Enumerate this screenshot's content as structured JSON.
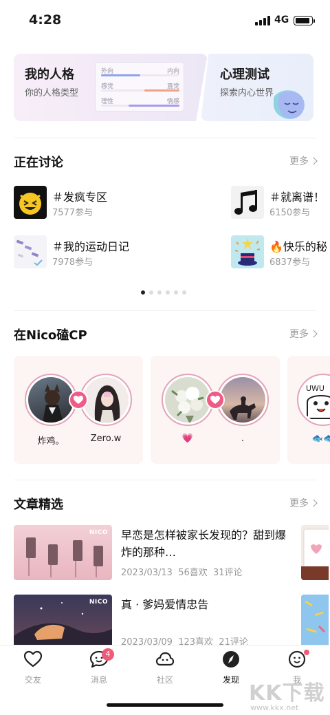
{
  "status": {
    "time": "4:28",
    "network": "4G"
  },
  "persona_card": {
    "title": "我的人格",
    "subtitle": "你的人格类型",
    "rows": [
      {
        "left": "外向",
        "right": "内向",
        "color": "#8fa3e8",
        "start": 0.0,
        "value": 0.5
      },
      {
        "left": "感觉",
        "right": "直觉",
        "color": "#f0a183",
        "start": 0.55,
        "value": 0.45
      },
      {
        "left": "理性",
        "right": "情感",
        "color": "#a69be6",
        "start": 0.35,
        "value": 0.65
      }
    ]
  },
  "psy_card": {
    "title": "心理测试",
    "subtitle": "探索内心世界"
  },
  "discussion": {
    "title": "正在讨论",
    "more": "更多",
    "topics": [
      {
        "name": "＃发疯专区",
        "count": "7577参与",
        "icon": "crazy-emoji-icon"
      },
      {
        "name": "＃就离谱！",
        "count": "6150参与",
        "icon": "music-note-icon"
      },
      {
        "name": "＃我的运动日记",
        "count": "7978参与",
        "icon": "sport-diary-thumb"
      },
      {
        "name": "🔥快乐的秘",
        "count": "6837参与",
        "icon": "magic-hat-thumb"
      }
    ],
    "page_dots": 6,
    "active_dot": 0
  },
  "cp": {
    "title": "在Nico磕CP",
    "more": "更多",
    "pairs": [
      {
        "left_name": "炸鸡。",
        "right_name": "Zero.w"
      },
      {
        "left_name": "💗",
        "right_name": "."
      },
      {
        "left_name": "🐟🐟",
        "right_name": ""
      }
    ]
  },
  "articles": {
    "title": "文章精选",
    "more": "更多",
    "items": [
      {
        "title": "早恋是怎样被家长发现的？甜到爆炸的那种…",
        "date": "2023/03/13",
        "likes": "56喜欢",
        "comments": "31评论",
        "tag": "NICO"
      },
      {
        "title": "真 · 爹妈爱情忠告",
        "date": "2023/03/09",
        "likes": "123喜欢",
        "comments": "21评论",
        "tag": "NICO"
      }
    ]
  },
  "tabs": [
    {
      "label": "交友",
      "icon": "heart-icon"
    },
    {
      "label": "消息",
      "icon": "chat-bubble-icon",
      "badge": "4"
    },
    {
      "label": "社区",
      "icon": "cloud-face-icon"
    },
    {
      "label": "发现",
      "icon": "compass-icon",
      "active": true
    },
    {
      "label": "我",
      "icon": "smile-face-icon"
    }
  ],
  "watermark": {
    "main": "KK下载",
    "url": "www.kkx.net"
  },
  "colors": {
    "accent_pink": "#ef5b86",
    "badge": "#f05a78",
    "active_dot": "#222222"
  }
}
